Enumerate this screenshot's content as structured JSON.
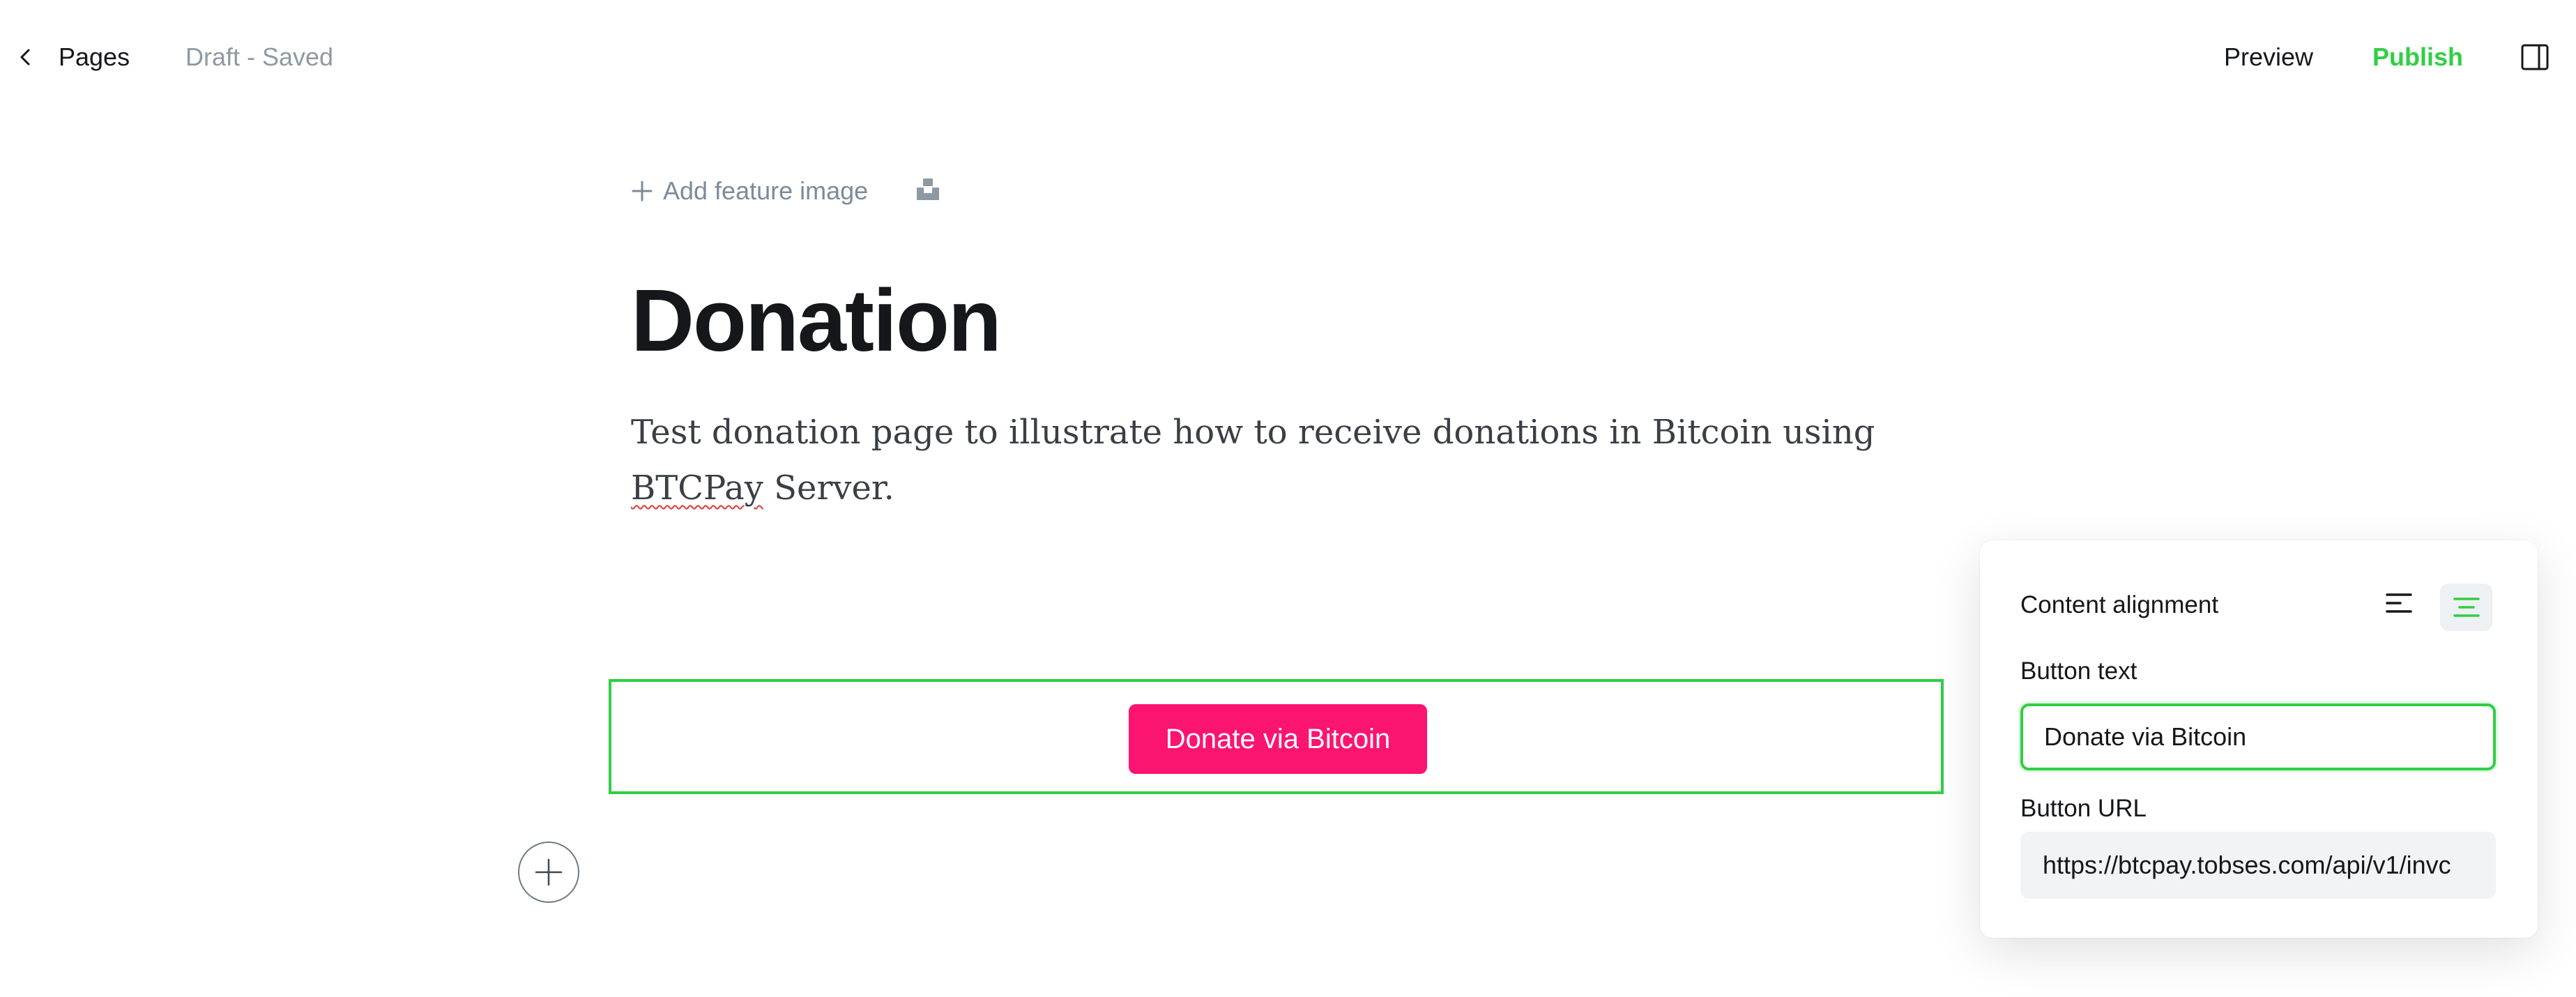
{
  "header": {
    "back_label": "Pages",
    "status": "Draft - Saved",
    "preview_label": "Preview",
    "publish_label": "Publish"
  },
  "editor": {
    "add_feature_image": "Add feature image",
    "title": "Donation",
    "excerpt_before": "Test donation page to illustrate how to receive donations in Bitcoin using ",
    "excerpt_misspelled": "BTCPay",
    "excerpt_after": " Server.",
    "button_card": {
      "label": "Donate via Bitcoin",
      "color": "#fb1470"
    }
  },
  "settings": {
    "alignment_label": "Content alignment",
    "alignment_selected": "center",
    "button_text_label": "Button text",
    "button_text_value": "Donate via Bitcoin",
    "button_url_label": "Button URL",
    "button_url_value": "https://btcpay.tobses.com/api/v1/invc"
  },
  "colors": {
    "accent_green": "#30cf43",
    "button_pink": "#fb1470",
    "muted_text": "#8e9aa3"
  }
}
